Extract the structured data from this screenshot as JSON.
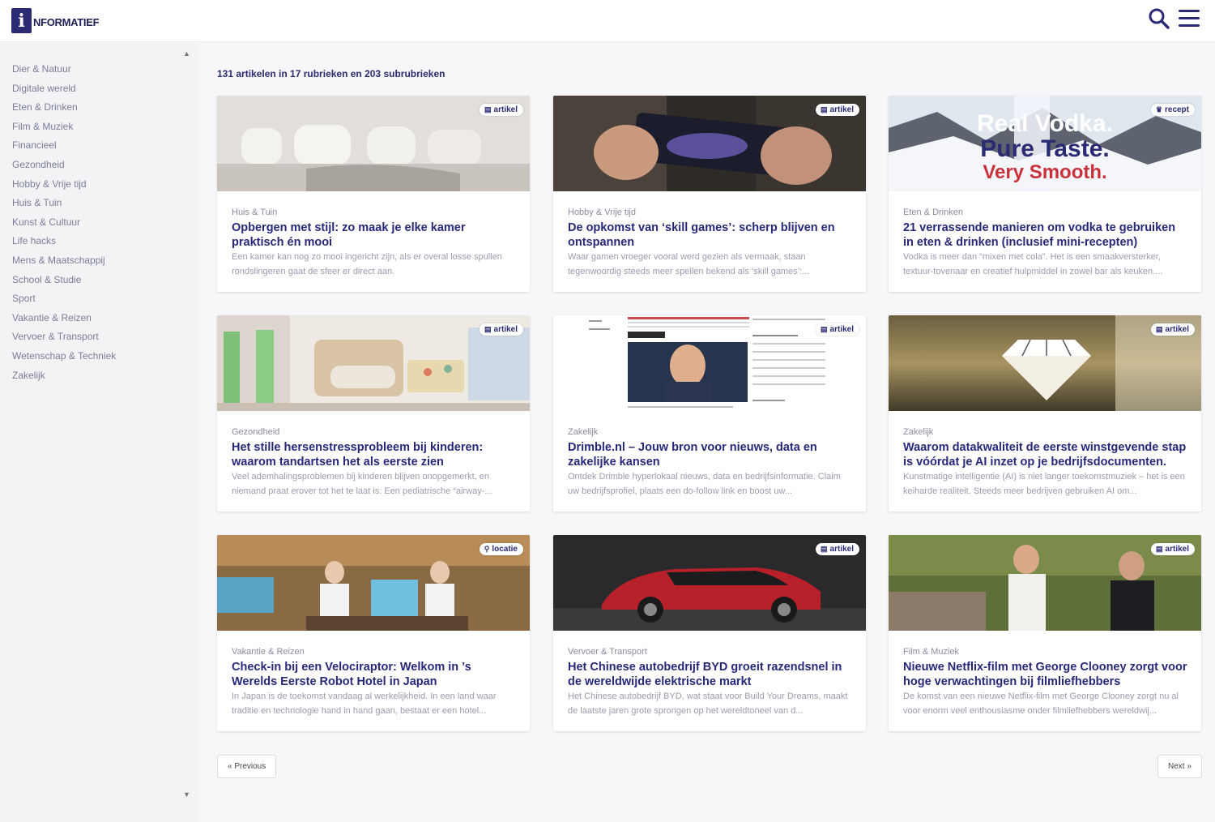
{
  "brand": {
    "logo_letter": "i",
    "logo_text": "NFORMATIEF",
    "accent": "#2a2b73"
  },
  "header": {
    "search_icon": "search-icon",
    "menu_icon": "hamburger-menu-icon"
  },
  "sidebar": {
    "items": [
      {
        "label": "Dier & Natuur"
      },
      {
        "label": "Digitale wereld"
      },
      {
        "label": "Eten & Drinken"
      },
      {
        "label": "Film & Muziek"
      },
      {
        "label": "Financieel"
      },
      {
        "label": "Gezondheid"
      },
      {
        "label": "Hobby & Vrije tijd"
      },
      {
        "label": "Huis & Tuin"
      },
      {
        "label": "Kunst & Cultuur"
      },
      {
        "label": "Life hacks"
      },
      {
        "label": "Mens & Maatschappij"
      },
      {
        "label": "School & Studie"
      },
      {
        "label": "Sport"
      },
      {
        "label": "Vakantie & Reizen"
      },
      {
        "label": "Vervoer & Transport"
      },
      {
        "label": "Wetenschap & Techniek"
      },
      {
        "label": "Zakelijk"
      }
    ]
  },
  "main": {
    "summary": "131 artikelen in 17 rubrieken en 203 subrubrieken",
    "cards": [
      {
        "badge": "artikel",
        "badge_icon": "newspaper-icon",
        "category": "Huis & Tuin",
        "title": "Opbergen met stijl: zo maak je elke kamer praktisch én mooi",
        "excerpt": "Een kamer kan nog zo mooi ingericht zijn, als er overal losse spullen rondslingeren gaat de sfeer er direct aan."
      },
      {
        "badge": "artikel",
        "badge_icon": "newspaper-icon",
        "category": "Hobby & Vrije tijd",
        "title": "De opkomst van ‘skill games’: scherp blijven en ontspannen",
        "excerpt": "Waar gamen vroeger vooral werd gezien als vermaak, staan tegenwoordig steeds meer spellen bekend als ‘skill games’:..."
      },
      {
        "badge": "recept",
        "badge_icon": "chef-hat-icon",
        "category": "Eten & Drinken",
        "title": "21 verrassende manieren om vodka te gebruiken in eten & drinken (inclusief mini-recepten)",
        "excerpt": "Vodka is meer dan “mixen met cola”. Het is een smaakversterker, textuur-tovenaar en creatief hulpmiddel in zowel bar als keuken....",
        "image_text": {
          "line1": "Real Vodka.",
          "line2": "Pure Taste.",
          "line3": "Very Smooth."
        }
      },
      {
        "badge": "artikel",
        "badge_icon": "newspaper-icon",
        "category": "Gezondheid",
        "title": "Het stille hersenstressprobleem bij kinderen: waarom tandartsen het als eerste zien",
        "excerpt": "Veel ademhalingsproblemen bij kinderen blijven onopgemerkt, en niemand praat erover tot het te laat is. Een pediatrische “airway-..."
      },
      {
        "badge": "artikel",
        "badge_icon": "newspaper-icon",
        "category": "Zakelijk",
        "title": "Drimble.nl – Jouw bron voor nieuws, data en zakelijke kansen",
        "excerpt": "Ontdek Drimble hyperlokaal nieuws, data en bedrijfsinformatie. Claim uw bedrijfsprofiel, plaats een do-follow link en boost uw..."
      },
      {
        "badge": "artikel",
        "badge_icon": "newspaper-icon",
        "category": "Zakelijk",
        "title": "Waarom datakwaliteit de eerste winstgevende stap is vóórdat je AI inzet op je bedrijfsdocumenten.",
        "excerpt": "Kunstmatige intelligentie (AI) is niet langer toekomstmuziek – het is een keiharde realiteit. Steeds meer bedrijven gebruiken AI om..."
      },
      {
        "badge": "locatie",
        "badge_icon": "map-pin-icon",
        "category": "Vakantie & Reizen",
        "title": "Check-in bij een Velociraptor: Welkom in ’s Werelds Eerste Robot Hotel in Japan",
        "excerpt": "In Japan is de toekomst vandaag al werkelijkheid. In een land waar traditie en technologie hand in hand gaan, bestaat er een hotel..."
      },
      {
        "badge": "artikel",
        "badge_icon": "newspaper-icon",
        "category": "Vervoer & Transport",
        "title": "Het Chinese autobedrijf BYD groeit razendsnel in de wereldwijde elektrische markt",
        "excerpt": "Het Chinese autobedrijf BYD, wat staat voor Build Your Dreams, maakt de laatste jaren grote sprongen op het wereldtoneel van d..."
      },
      {
        "badge": "artikel",
        "badge_icon": "newspaper-icon",
        "category": "Film & Muziek",
        "title": "Nieuwe Netflix-film met George Clooney zorgt voor hoge verwachtingen bij filmliefhebbers",
        "excerpt": "De komst van een nieuwe Netflix-film met George Clooney zorgt nu al voor enorm veel enthousiasme onder filmliefhebbers wereldwij..."
      }
    ]
  },
  "pagination": {
    "previous": "« Previous",
    "next": "Next »"
  }
}
